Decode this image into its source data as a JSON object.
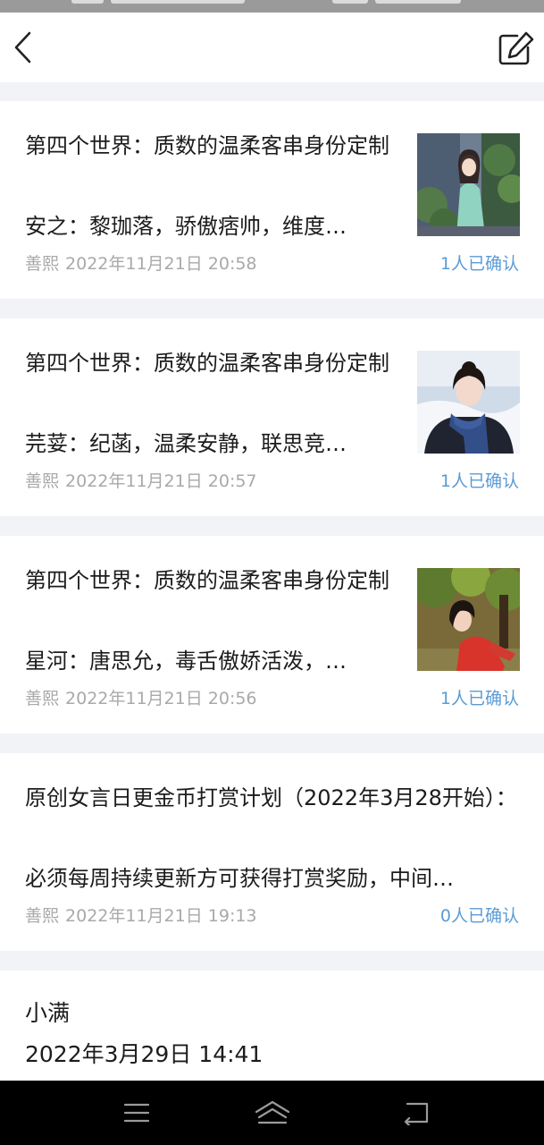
{
  "status_bar": {},
  "top_bar": {
    "back_icon": "chevron-left-icon",
    "edit_icon": "edit-note-icon"
  },
  "posts": [
    {
      "title": "第四个世界：质数的温柔客串身份定制",
      "snippet": "安之：黎珈落，骄傲痞帅，维度…",
      "author": "善熙",
      "time": "2022年11月21日 20:58",
      "confirm": "1人已确认",
      "thumb": "girl-green-dress-garden"
    },
    {
      "title": "第四个世界：质数的温柔客串身份定制",
      "snippet": "芫荽：纪菡，温柔安静，联思竞…",
      "author": "善熙",
      "time": "2022年11月21日 20:57",
      "confirm": "1人已确认",
      "thumb": "girl-blue-scarf-snow"
    },
    {
      "title": "第四个世界：质数的温柔客串身份定制",
      "snippet": "星河：唐思允，毒舌傲娇活泼，…",
      "author": "善熙",
      "time": "2022年11月21日 20:56",
      "confirm": "1人已确认",
      "thumb": "girl-red-top-autumn"
    },
    {
      "title": "原创女言日更金币打赏计划（2022年3月28开始）：",
      "snippet": "必须每周持续更新方可获得打赏奖励，中间…",
      "author": "善熙",
      "time": "2022年11月21日 19:13",
      "confirm": "0人已确认"
    }
  ],
  "partial_post": {
    "author": "小满",
    "time": "2022年3月29日 14:41"
  },
  "nav_bar": {
    "menu_icon": "menu-icon",
    "home_icon": "home-icon",
    "back_icon": "back-arrow-icon"
  },
  "colors": {
    "background": "#f2f3f7",
    "card": "#ffffff",
    "text": "#1c1c1c",
    "meta": "#a9a9a9",
    "link": "#5b9bd5",
    "nav": "#000000"
  }
}
